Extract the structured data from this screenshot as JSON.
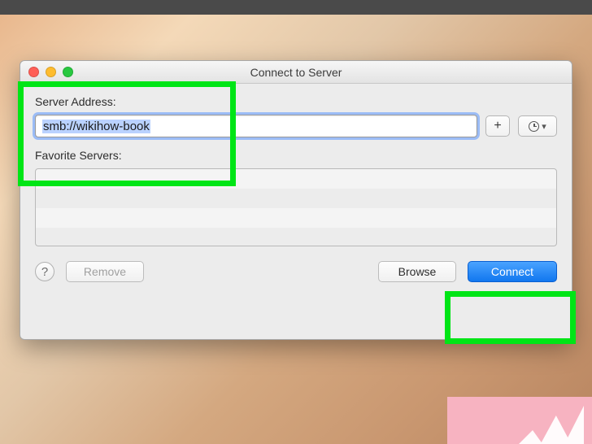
{
  "window": {
    "title": "Connect to Server"
  },
  "labels": {
    "server_address": "Server Address:",
    "favorite_servers": "Favorite Servers:"
  },
  "input": {
    "server_address_value": "smb://wikihow-book"
  },
  "buttons": {
    "add": "+",
    "help": "?",
    "remove": "Remove",
    "browse": "Browse",
    "connect": "Connect"
  },
  "colors": {
    "highlight": "#00e516",
    "primary": "#1177ef"
  }
}
